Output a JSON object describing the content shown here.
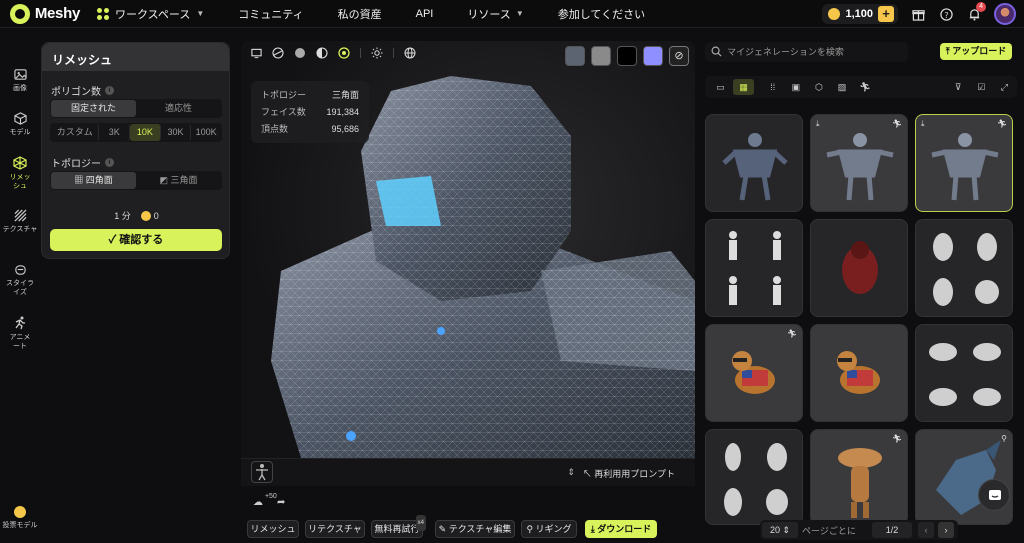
{
  "brand": {
    "name": "Meshy"
  },
  "nav": {
    "workspace": "ワークスペース",
    "community": "コミュニティ",
    "assets": "私の資産",
    "api": "API",
    "resources": "リソース",
    "join": "参加してください"
  },
  "topbar": {
    "credits": "1,100",
    "notif_count": "4"
  },
  "rail": {
    "image": "画像",
    "model": "モデル",
    "remesh": "リメッシュ",
    "texture": "テクスチャ",
    "stylize": "スタイライズ",
    "animate": "アニメート",
    "vote": "投票モデル"
  },
  "remesh_panel": {
    "title": "リメッシュ",
    "polycount_label": "ポリゴン数",
    "mode_options": [
      "固定された",
      "適応性"
    ],
    "mode_selected": "固定された",
    "count_options": [
      "カスタム",
      "3K",
      "10K",
      "30K",
      "100K"
    ],
    "count_selected": "10K",
    "topology_label": "トポロジー",
    "topology_options": [
      "四角面",
      "三角面"
    ],
    "topology_selected": "四角面",
    "time": "1 分",
    "cost": "0",
    "confirm": "確認する"
  },
  "stats": {
    "rows": [
      {
        "k": "トポロジー",
        "v": "三角面"
      },
      {
        "k": "フェイス数",
        "v": "191,384"
      },
      {
        "k": "頂点数",
        "v": "95,686"
      }
    ]
  },
  "viewer": {
    "reuse_prompt": "再利用用プロンプト",
    "swatch_colors": [
      "#5b6470",
      "#8a8a8a",
      "#000000",
      "#8f8fff"
    ],
    "accent": "#d7f25a"
  },
  "actions": {
    "boost": "+50",
    "buttons": [
      "リメッシュ",
      "リテクスチャ",
      "無料再試行",
      "テクスチャ編集",
      "リギング",
      "ダウンロード"
    ],
    "retry_badge": "x4"
  },
  "gallery": {
    "search_placeholder": "マイジェネレーションを検索",
    "upload": "アップロード"
  },
  "pager": {
    "per_page": "20",
    "per_page_label": "ページごとに",
    "page": "1/2"
  }
}
